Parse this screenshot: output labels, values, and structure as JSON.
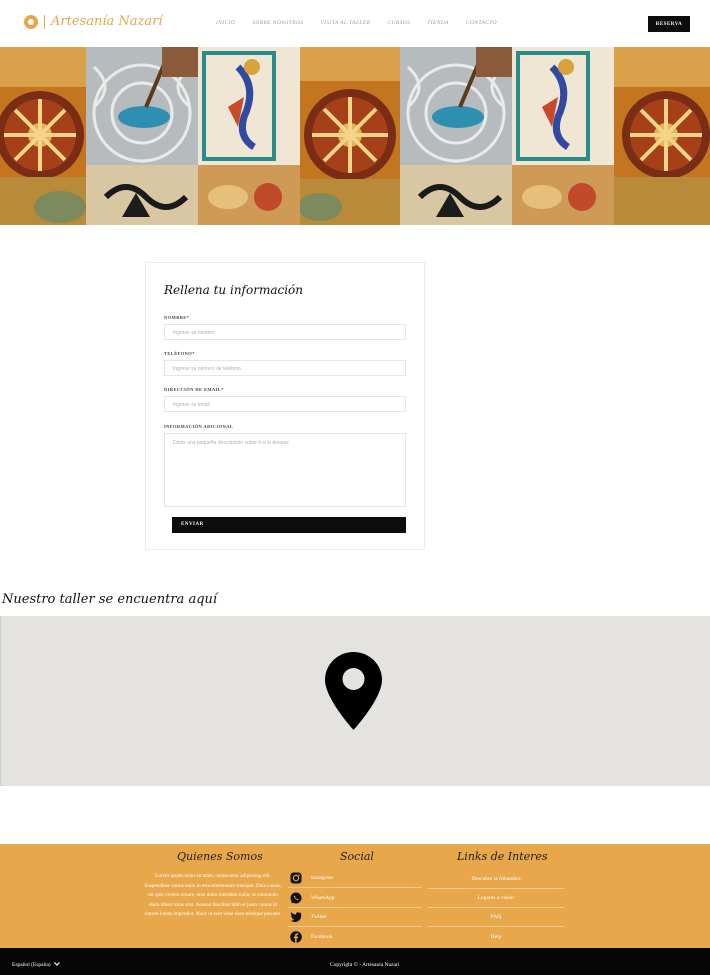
{
  "header": {
    "brand": "Artesanía Nazarí",
    "nav": [
      "INICIO",
      "SOBRE NOSOTROS",
      "VISITA AL TALLER",
      "CURSOS",
      "TIENDA",
      "CONTACTO"
    ],
    "reserve_label": "RESERVA"
  },
  "form": {
    "title": "Rellena tu información",
    "name_label": "NOMBRE*",
    "name_placeholder": "Ingrese su nombre",
    "phone_label": "TELÉFONO*",
    "phone_placeholder": "Ingrese su número de teléfono",
    "email_label": "DIRECCIÓN DE EMAIL*",
    "email_placeholder": "Ingrese su email",
    "info_label": "INFORMACIÓN ADICIONAL",
    "info_placeholder": "Dinos una pequeña descripción sobre ti si lo deseas",
    "submit_label": "ENVIAR"
  },
  "map": {
    "title": "Nuestro taller se encuentra aquí"
  },
  "footer": {
    "about_title": "Quienes Somos",
    "about_text": "Lorem ipsum dolor sit amet, consectetur adipiscing elit. Suspendisse varius enim in eros elementum tristique. Duis cursus, mi quis viverra ornare, eros dolor interdum nulla, ut commodo diam libero vitae erat. Aenean faucibus nibh et justo cursus id rutrum lorem imperdiet. Nunc ut sem vitae risus tristique posuere.",
    "social_title": "Social",
    "social": [
      {
        "label": "Instagram",
        "icon": "instagram-icon"
      },
      {
        "label": "WhatsApp",
        "icon": "whatsapp-icon"
      },
      {
        "label": "Twitter",
        "icon": "twitter-icon"
      },
      {
        "label": "Facebook",
        "icon": "facebook-icon"
      }
    ],
    "links_title": "Links de Interes",
    "links": [
      "Descubre la Alhambra",
      "Lugares a visitar",
      "FAQ",
      "Help"
    ],
    "language": "Español (España)",
    "copyright": "Copyright © - Artesanía Nazarí"
  },
  "colors": {
    "accent": "#e8a74b",
    "dark": "#0d0d0d",
    "map_bg": "#e4e3e0"
  }
}
